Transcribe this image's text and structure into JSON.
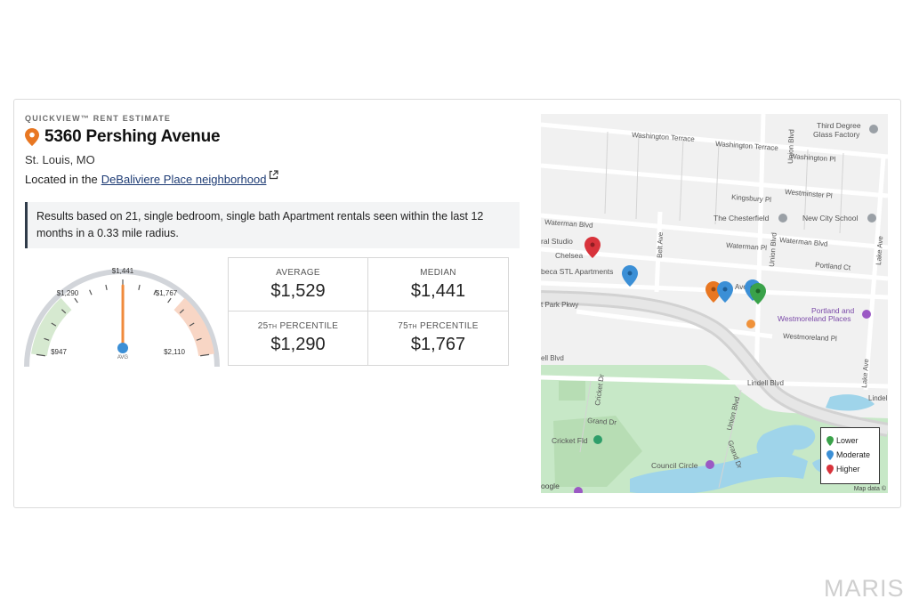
{
  "header": {
    "eyebrow": "QUICKVIEW™ RENT ESTIMATE",
    "address": "5360 Pershing Avenue",
    "city": "St. Louis, MO",
    "located_prefix": "Located in the",
    "neighborhood_link": "DeBaliviere Place neighborhood"
  },
  "note": "Results based on 21, single bedroom, single bath Apartment rentals seen within the last 12 months in a 0.33 mile radius.",
  "gauge": {
    "labels": {
      "low": "$947",
      "p25": "$1,290",
      "median": "$1,441",
      "p75": "$1,767",
      "high": "$2,110",
      "avg": "AVG"
    },
    "min": 947,
    "max": 2110,
    "value": 1529
  },
  "stats": [
    {
      "label": "AVERAGE",
      "value": "$1,529"
    },
    {
      "label": "MEDIAN",
      "value": "$1,441"
    },
    {
      "label_num": "25",
      "label_suffix": "TH",
      "label_rest": " PERCENTILE",
      "value": "$1,290"
    },
    {
      "label_num": "75",
      "label_suffix": "TH",
      "label_rest": " PERCENTILE",
      "value": "$1,767"
    }
  ],
  "map": {
    "streets": {
      "washington_terrace": "Washington Terrace",
      "washington_terrace_2": "Washington Terrace",
      "washington_pl": "Washington Pl",
      "kingsbury_pl": "Kingsbury Pl",
      "westminster_pl": "Westminster Pl",
      "waterman_blvd_left": "Waterman Blvd",
      "waterman_pl": "Waterman Pl",
      "waterman_blvd_right": "Waterman Blvd",
      "portland_ct": "Portland Ct",
      "belt_ave": "Belt Ave",
      "union_blvd": "Union Blvd",
      "union_blvd_2": "Union Blvd",
      "lake_ave": "Lake Ave",
      "lake_ave_2": "Lake Ave",
      "park_pkwy": "t Park Pkwy",
      "westmoreland_pl": "Westmoreland Pl",
      "lindell_blvd": "Lindell Blvd",
      "lindell_blvd_left": "ell Blvd",
      "lindell_right": "Lindel",
      "cricket_dr": "Cricket Dr",
      "grand_dr": "Grand Dr",
      "grand_dr_2": "Grand Dr",
      "ave": "Ave"
    },
    "places": {
      "third_degree": "Third Degree",
      "glass_factory": "Glass Factory",
      "chesterfield": "The Chesterfield",
      "new_city_school": "New City School",
      "ral_studio": "ral Studio",
      "chelsea": "Chelsea",
      "tribeca": "beca STL Apartments",
      "portland_and": "Portland and",
      "westmoreland_places": "Westmoreland Places",
      "cricket_fld": "Cricket Fld",
      "council_circle": "Council Circle",
      "google": "oogle"
    },
    "legend": [
      {
        "label": "Lower",
        "color": "#3aa24a"
      },
      {
        "label": "Moderate",
        "color": "#3b8fd6"
      },
      {
        "label": "Higher",
        "color": "#d8333b"
      }
    ],
    "attribution": "Map data ©"
  },
  "colors": {
    "pin_orange": "#e87722",
    "needle": "#f08a3c",
    "hub": "#3b8fd6",
    "low_band": "#d6e9d0",
    "high_band": "#f8d6c5"
  },
  "watermark": "MARIS"
}
